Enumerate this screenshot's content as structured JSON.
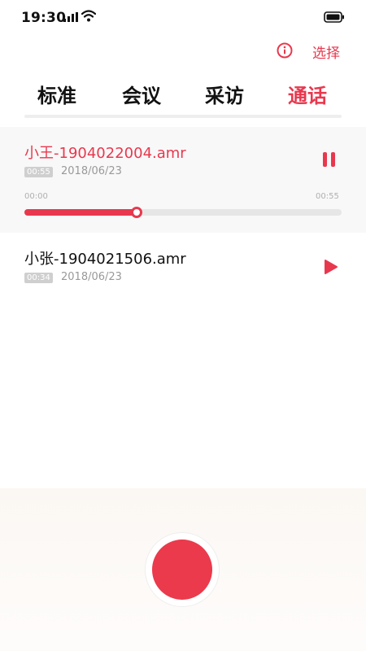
{
  "status_bar": {
    "time": "19:30"
  },
  "header": {
    "select_label": "选择"
  },
  "tabs": [
    {
      "label": "标准"
    },
    {
      "label": "会议"
    },
    {
      "label": "采访"
    },
    {
      "label": "通话"
    }
  ],
  "active_tab": "通话",
  "recordings": [
    {
      "title": "小王-1904022004.amr",
      "duration": "00:55",
      "date": "2018/06/23",
      "playing": true,
      "elapsed": "00:00",
      "total": "00:55",
      "progress": 0.355
    },
    {
      "title": "小张-1904021506.amr",
      "duration": "00:34",
      "date": "2018/06/23",
      "playing": false
    }
  ],
  "colors": {
    "accent": "#e8384e",
    "record_button": "#ea3a4c"
  },
  "icons": {
    "info": "info-icon",
    "pause": "pause-icon",
    "play": "play-icon",
    "signal": "signal-icon",
    "wifi": "wifi-icon",
    "battery": "battery-icon"
  }
}
